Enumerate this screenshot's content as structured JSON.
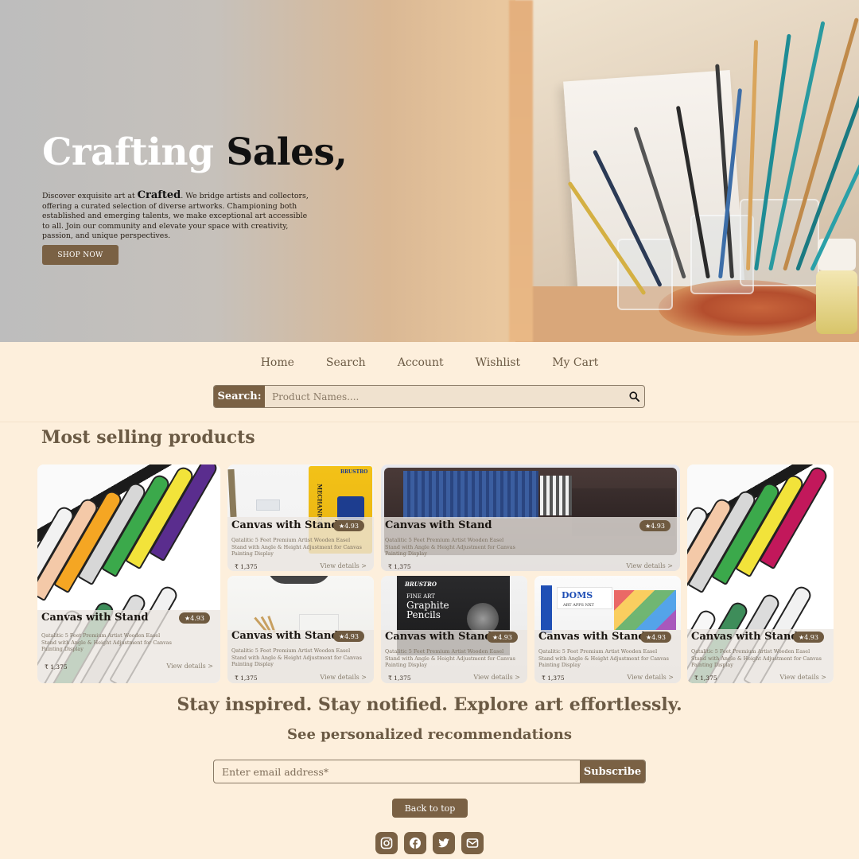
{
  "hero": {
    "title_light": "Crafting",
    "title_bold": "Sales,",
    "desc_pre": "Discover exquisite art at",
    "brand": "Crafted",
    "desc_post": ". We bridge artists and collectors, offering a curated selection of diverse artworks. Championing both established and emerging talents, we make exceptional art accessible to all. Join our community and elevate your space with creativity, passion, and unique perspectives.",
    "cta": "SHOP NOW"
  },
  "nav": {
    "items": [
      "Home",
      "Search",
      "Account",
      "Wishlist",
      "My Cart"
    ]
  },
  "search": {
    "label": "Search:",
    "placeholder": "Product Names...."
  },
  "section": {
    "title": "Most selling products"
  },
  "products": [
    {
      "title": "Canvas with Stand",
      "rating": "★4.93",
      "desc": "Qatalitic 5 Feet Premium Artist Wooden Easel Stand with Angle & Height Adjustment for Canvas Painting Display",
      "price": "₹ 1,375",
      "view": "View details >"
    },
    {
      "title": "Canvas with Stand",
      "rating": "★4.93",
      "desc": "Qatalitic 5 Feet Premium Artist Wooden Easel Stand with Angle & Height Adjustment for Canvas Painting Display",
      "price": "₹ 1,375",
      "view": "View details >"
    },
    {
      "title": "Canvas with Stand",
      "rating": "★4.93",
      "desc": "Qatalitic 5 Feet Premium Artist Wooden Easel Stand with Angle & Height Adjustment for Canvas Painting Display",
      "price": "₹ 1,375",
      "view": "View details >"
    },
    {
      "title": "Canvas with Stand",
      "rating": "★4.93",
      "desc": "Qatalitic 5 Feet Premium Artist Wooden Easel Stand with Angle & Height Adjustment for Canvas Painting Display",
      "price": "₹ 1,375",
      "view": "View details >"
    },
    {
      "title": "Canvas with Stand",
      "rating": "★4.93",
      "desc": "Qatalitic 5 Feet Premium Artist Wooden Easel Stand with Angle & Height Adjustment for Canvas Painting Display",
      "price": "₹ 1,375",
      "view": "View details >"
    },
    {
      "title": "Canvas with Stand",
      "rating": "★4.93",
      "desc": "Qatalitic 5 Feet Premium Artist Wooden Easel Stand with Angle & Height Adjustment for Canvas Painting Display",
      "price": "₹ 1,375",
      "view": "View details >"
    },
    {
      "title": "Canvas with Stand",
      "rating": "★4.93",
      "desc": "Qatalitic 5 Feet Premium Artist Wooden Easel Stand with Angle & Height Adjustment for Canvas Painting Display",
      "price": "₹ 1,375",
      "view": "View details >"
    },
    {
      "title": "Canvas with Stand",
      "rating": "★4.93",
      "desc": "Qatalitic 5 Feet Premium Artist Wooden Easel Stand with Angle & Height Adjustment for Canvas Painting Display",
      "price": "₹ 1,375",
      "view": "View details >"
    }
  ],
  "product_images": {
    "pencils_brand": "BRUSTRO",
    "pencils_label": "MECHANICAL",
    "graphite_brand": "BRUSTRO",
    "graphite_l1": "FINE ART",
    "graphite_l2": "Graphite",
    "graphite_l3": "Pencils",
    "doms_brand": "DOMS",
    "doms_sub": "ART APPS NXT"
  },
  "newsletter": {
    "tagline": "Stay inspired. Stay notified. Explore art effortlessly.",
    "subtag": "See personalized recommendations",
    "placeholder": "Enter email address*",
    "button": "Subscribe"
  },
  "footer": {
    "back_to_top": "Back to top",
    "socials": [
      "instagram-icon",
      "facebook-icon",
      "twitter-icon",
      "mail-icon"
    ]
  },
  "colors": {
    "background": "#fdefdc",
    "accent": "#7a6144",
    "text": "#6b5a44"
  }
}
